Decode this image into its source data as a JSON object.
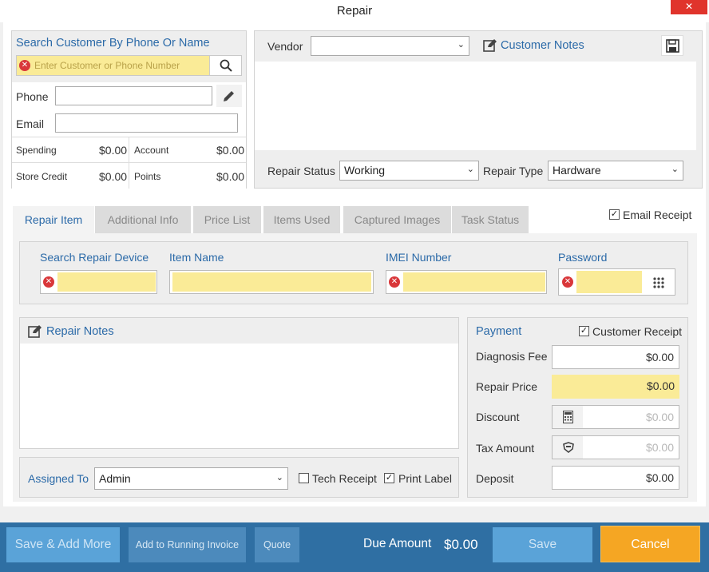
{
  "window": {
    "title": "Repair",
    "close_glyph": "✕"
  },
  "customer": {
    "search_label": "Search Customer By Phone Or Name",
    "search_placeholder": "Enter Customer or Phone Number",
    "phone_label": "Phone",
    "phone_value": "",
    "email_label": "Email",
    "email_value": "",
    "spending_label": "Spending",
    "spending_value": "$0.00",
    "account_label": "Account",
    "account_value": "$0.00",
    "store_credit_label": "Store Credit",
    "store_credit_value": "$0.00",
    "points_label": "Points",
    "points_value": "$0.00"
  },
  "vendor": {
    "label": "Vendor",
    "value": "",
    "notes_label": "Customer Notes",
    "notes_value": ""
  },
  "status": {
    "repair_status_label": "Repair Status",
    "repair_status_value": "Working",
    "repair_type_label": "Repair Type",
    "repair_type_value": "Hardware"
  },
  "tabs": [
    {
      "label": "Repair Item"
    },
    {
      "label": "Additional Info"
    },
    {
      "label": "Price List"
    },
    {
      "label": "Items Used"
    },
    {
      "label": "Captured Images"
    },
    {
      "label": "Task Status"
    }
  ],
  "email_receipt_label": "Email Receipt",
  "device": {
    "search_label": "Search Repair Device",
    "item_name_label": "Item Name",
    "imei_label": "IMEI Number",
    "password_label": "Password"
  },
  "notes": {
    "label": "Repair Notes",
    "value": ""
  },
  "assign": {
    "label": "Assigned To",
    "value": "Admin",
    "tech_receipt_label": "Tech Receipt",
    "print_label_label": "Print Label"
  },
  "payment": {
    "title": "Payment",
    "customer_receipt_label": "Customer Receipt",
    "diagnosis_fee_label": "Diagnosis Fee",
    "diagnosis_fee_value": "$0.00",
    "repair_price_label": "Repair Price",
    "repair_price_value": "$0.00",
    "discount_label": "Discount",
    "discount_value": "$0.00",
    "tax_amount_label": "Tax Amount",
    "tax_amount_value": "$0.00",
    "deposit_label": "Deposit",
    "deposit_value": "$0.00"
  },
  "footer": {
    "save_add_more": "Save & Add More",
    "add_running_invoice": "Add to Running Invoice",
    "quote": "Quote",
    "due_amount_label": "Due Amount",
    "due_amount_value": "$0.00",
    "save": "Save",
    "cancel": "Cancel"
  },
  "colors": {
    "accent": "#2b6aa8",
    "bottom_bar": "#2f6fa3",
    "cancel": "#f5a623",
    "highlight": "#faeb97"
  }
}
